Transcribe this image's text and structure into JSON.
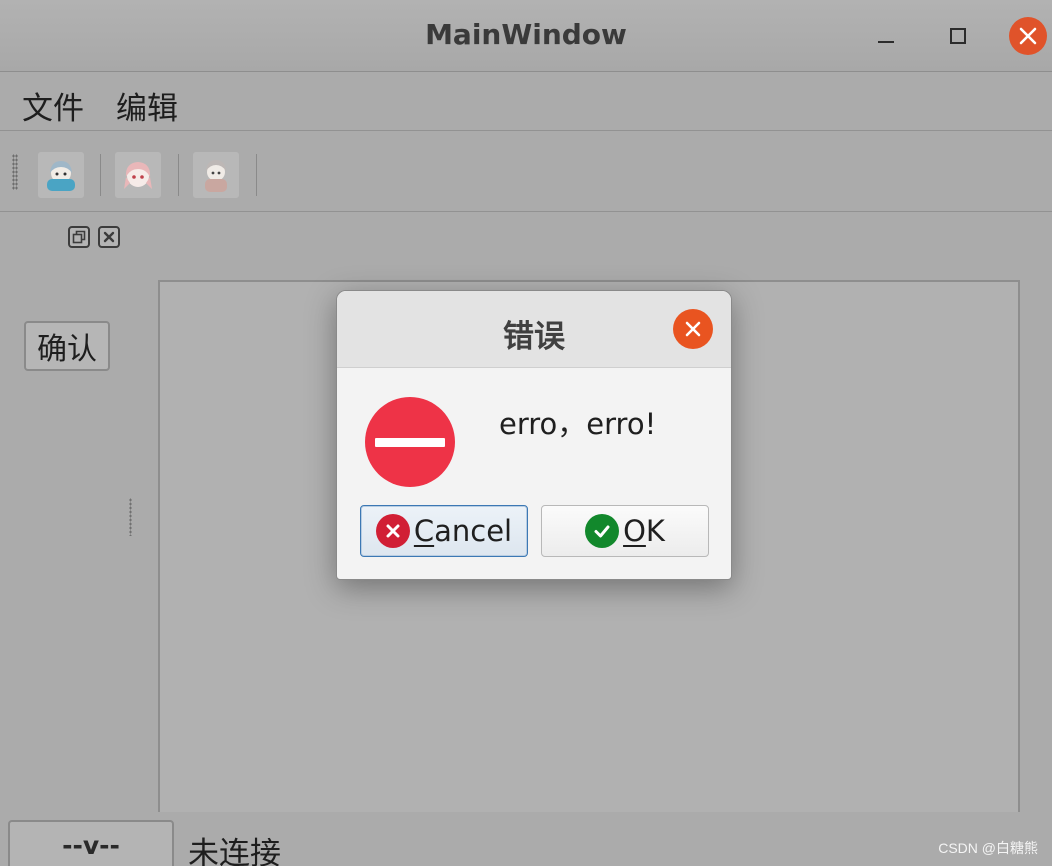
{
  "window": {
    "title": "MainWindow",
    "controls": {
      "minimize": "minimize-icon",
      "maximize": "maximize-icon",
      "close": "close-icon"
    }
  },
  "menubar": {
    "items": [
      {
        "label": "文件"
      },
      {
        "label": "编辑"
      }
    ]
  },
  "toolbar": {
    "actions": [
      {
        "icon": "avatar-blue-icon"
      },
      {
        "icon": "avatar-pink-icon"
      },
      {
        "icon": "avatar-grey-icon"
      }
    ]
  },
  "dock": {
    "confirm_label": "确认"
  },
  "statusbar": {
    "button_label": "--v--",
    "status_text": "未连接"
  },
  "watermark": "CSDN @白糖熊",
  "dialog": {
    "title": "错误",
    "message": "erro，erro!",
    "cancel": {
      "mnemonic": "C",
      "rest": "ancel"
    },
    "ok": {
      "mnemonic": "O",
      "rest": "K"
    }
  },
  "colors": {
    "close_orange": "#e95420",
    "critical_red": "#ee3347",
    "cancel_red": "#d11f35",
    "ok_green": "#12882c",
    "focus_blue": "#3c78b4"
  }
}
